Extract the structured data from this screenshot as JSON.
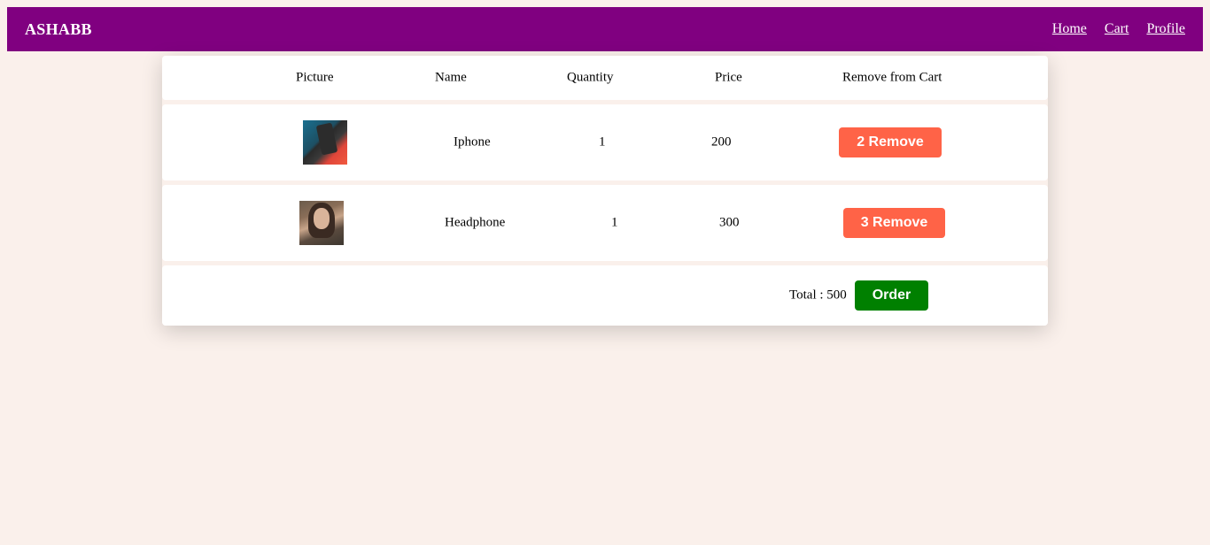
{
  "navbar": {
    "brand": "ASHABB",
    "links": [
      {
        "label": "Home"
      },
      {
        "label": "Cart"
      },
      {
        "label": "Profile"
      }
    ]
  },
  "cart": {
    "columns": [
      "Picture",
      "Name",
      "Quantity",
      "Price",
      "Remove from Cart"
    ],
    "items": [
      {
        "name": "Iphone",
        "quantity": "1",
        "price": "200",
        "remove_label": "2 Remove",
        "picture": "iphone-photo"
      },
      {
        "name": "Headphone",
        "quantity": "1",
        "price": "300",
        "remove_label": "3 Remove",
        "picture": "headphone-photo"
      }
    ],
    "total_text": "Total : 500",
    "order_label": "Order"
  },
  "colors": {
    "navbar": "#800080",
    "background": "#faf0eb",
    "remove_button": "#ff6347",
    "order_button": "#008000"
  }
}
